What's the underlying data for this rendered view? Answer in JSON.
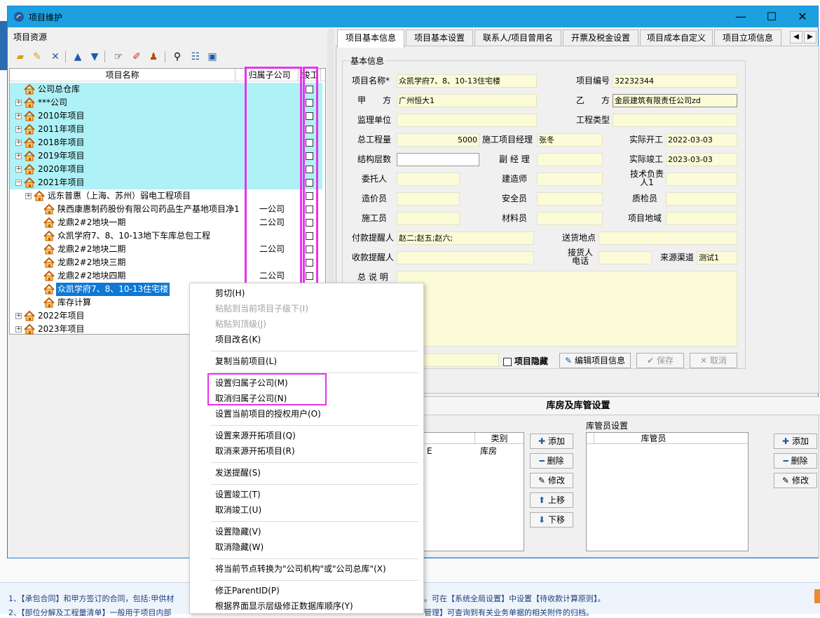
{
  "window": {
    "title": "项目维护"
  },
  "left": {
    "header": "项目资源",
    "columns": {
      "name": "项目名称",
      "sub": "归属子公司",
      "done": "竣工"
    },
    "rows": [
      {
        "label": "公司总仓库",
        "sub": "",
        "level": 0,
        "toggle": "",
        "cyan": true
      },
      {
        "label": "***公司",
        "sub": "",
        "level": 0,
        "toggle": "+",
        "cyan": true
      },
      {
        "label": "2010年项目",
        "sub": "",
        "level": 0,
        "toggle": "+",
        "cyan": true
      },
      {
        "label": "2011年项目",
        "sub": "",
        "level": 0,
        "toggle": "+",
        "cyan": true
      },
      {
        "label": "2018年项目",
        "sub": "",
        "level": 0,
        "toggle": "+",
        "cyan": true
      },
      {
        "label": "2019年项目",
        "sub": "",
        "level": 0,
        "toggle": "+",
        "cyan": true
      },
      {
        "label": "2020年项目",
        "sub": "",
        "level": 0,
        "toggle": "+",
        "cyan": true
      },
      {
        "label": "2021年项目",
        "sub": "",
        "level": 0,
        "toggle": "-",
        "cyan": true
      },
      {
        "label": "远东普惠（上海、苏州）弱电工程项目",
        "sub": "",
        "level": 1,
        "toggle": "+",
        "cyan": false
      },
      {
        "label": "陕西康惠制药股份有限公司药品生产基地项目净1",
        "sub": "一公司",
        "level": 2,
        "toggle": "",
        "cyan": false
      },
      {
        "label": "龙鼎2#2地块一期",
        "sub": "二公司",
        "level": 2,
        "toggle": "",
        "cyan": false
      },
      {
        "label": "众凯学府7、8、10-13地下车库总包工程",
        "sub": "",
        "level": 2,
        "toggle": "",
        "cyan": false
      },
      {
        "label": "龙鼎2#2地块二期",
        "sub": "二公司",
        "level": 2,
        "toggle": "",
        "cyan": false
      },
      {
        "label": "龙鼎2#2地块三期",
        "sub": "",
        "level": 2,
        "toggle": "",
        "cyan": false
      },
      {
        "label": "龙鼎2#2地块四期",
        "sub": "二公司",
        "level": 2,
        "toggle": "",
        "cyan": false
      },
      {
        "label": "众凯学府7、8、10-13住宅楼",
        "sub": "",
        "level": 2,
        "toggle": "",
        "cyan": false,
        "selected": true
      },
      {
        "label": "库存计算",
        "sub": "",
        "level": 2,
        "toggle": "",
        "cyan": false
      },
      {
        "label": "2022年项目",
        "sub": "",
        "level": 0,
        "toggle": "+",
        "cyan": false
      },
      {
        "label": "2023年项目",
        "sub": "",
        "level": 0,
        "toggle": "+",
        "cyan": false
      }
    ]
  },
  "tabs": [
    "项目基本信息",
    "项目基本设置",
    "联系人/项目曾用名",
    "开票及税金设置",
    "项目成本自定义",
    "项目立项信息"
  ],
  "form": {
    "group_title": "基本信息",
    "labels": {
      "name": "项目名称*",
      "code": "项目编号",
      "jia": "甲　　方",
      "yi": "乙　　方",
      "supervisor": "监理单位",
      "type": "工程类型",
      "total": "总工程量",
      "pm": "施工项目经理",
      "start": "实际开工",
      "structure": "结构层数",
      "deputy": "副 经 理",
      "finish": "实际竣工",
      "client": "委托人",
      "builder": "建造师",
      "tech": "技术负责人1",
      "cost": "造价员",
      "safety": "安全员",
      "qc": "质检员",
      "worker": "施工员",
      "material": "材料员",
      "area": "项目地域",
      "pay_remind": "付款提醒人",
      "deliver": "送货地点",
      "recv_remind": "收款提醒人",
      "receiver": "接货人电话",
      "channel": "来源渠道",
      "memo": "总 说 明"
    },
    "values": {
      "name": "众凯学府7、8、10-13住宅楼",
      "code": "32232344",
      "jia": "广州恒大1",
      "yi": "金辰建筑有限责任公司zd",
      "total": "5000",
      "pm": "张冬",
      "start": "2022-03-03",
      "finish": "2023-03-03",
      "pay_remind": "赵二;赵五;赵六;",
      "channel": "测试1"
    },
    "hidden_label": "项目隐藏",
    "edit_btn": "编辑项目信息",
    "save_btn": "保存",
    "cancel_btn": "取消"
  },
  "warehouse": {
    "title": "库房及库管设置",
    "col_type": "类别",
    "cell_suffix": "E",
    "cell_type": "库房",
    "keeper_title": "库管员设置",
    "keeper_col": "库管员",
    "btn_add": "添加",
    "btn_del": "删除",
    "btn_edit": "修改",
    "btn_up": "上移",
    "btn_down": "下移"
  },
  "menu": [
    {
      "label": "剪切(H)",
      "disabled": false
    },
    {
      "label": "粘贴到当前项目子级下(I)",
      "disabled": true
    },
    {
      "label": "粘贴到顶级(J)",
      "disabled": true
    },
    {
      "label": "项目改名(K)",
      "disabled": false
    },
    {
      "sep": true
    },
    {
      "label": "复制当前项目(L)",
      "disabled": false
    },
    {
      "sep": true
    },
    {
      "label": "设置归属子公司(M)",
      "disabled": false
    },
    {
      "label": "取消归属子公司(N)",
      "disabled": false
    },
    {
      "label": "设置当前项目的授权用户(O)",
      "disabled": false
    },
    {
      "sep": true
    },
    {
      "label": "设置来源开拓项目(Q)",
      "disabled": false
    },
    {
      "label": "取消来源开拓项目(R)",
      "disabled": false
    },
    {
      "sep": true
    },
    {
      "label": "发送提醒(S)",
      "disabled": false
    },
    {
      "sep": true
    },
    {
      "label": "设置竣工(T)",
      "disabled": false
    },
    {
      "label": "取消竣工(U)",
      "disabled": false
    },
    {
      "sep": true
    },
    {
      "label": "设置隐藏(V)",
      "disabled": false
    },
    {
      "label": "取消隐藏(W)",
      "disabled": false
    },
    {
      "sep": true
    },
    {
      "label": "将当前节点转换为\"公司机构\"或\"公司总库\"(X)",
      "disabled": false
    },
    {
      "sep": true
    },
    {
      "label": "修正ParentID(P)",
      "disabled": false
    },
    {
      "label": "根据界面显示层级修正数据库顺序(Y)",
      "disabled": false
    }
  ],
  "hints": {
    "line1_left": "1、【承包合同】和甲方签订的合同，包括:甲供材",
    "line1_right": "。可在【系统全局设置】中设置【待收款计算原则】。",
    "line2_left": "2、【部位分解及工程量清单】一般用于项目内部",
    "line2_right": "管理】可查询到有关业务单据的相关附件的归档。"
  }
}
